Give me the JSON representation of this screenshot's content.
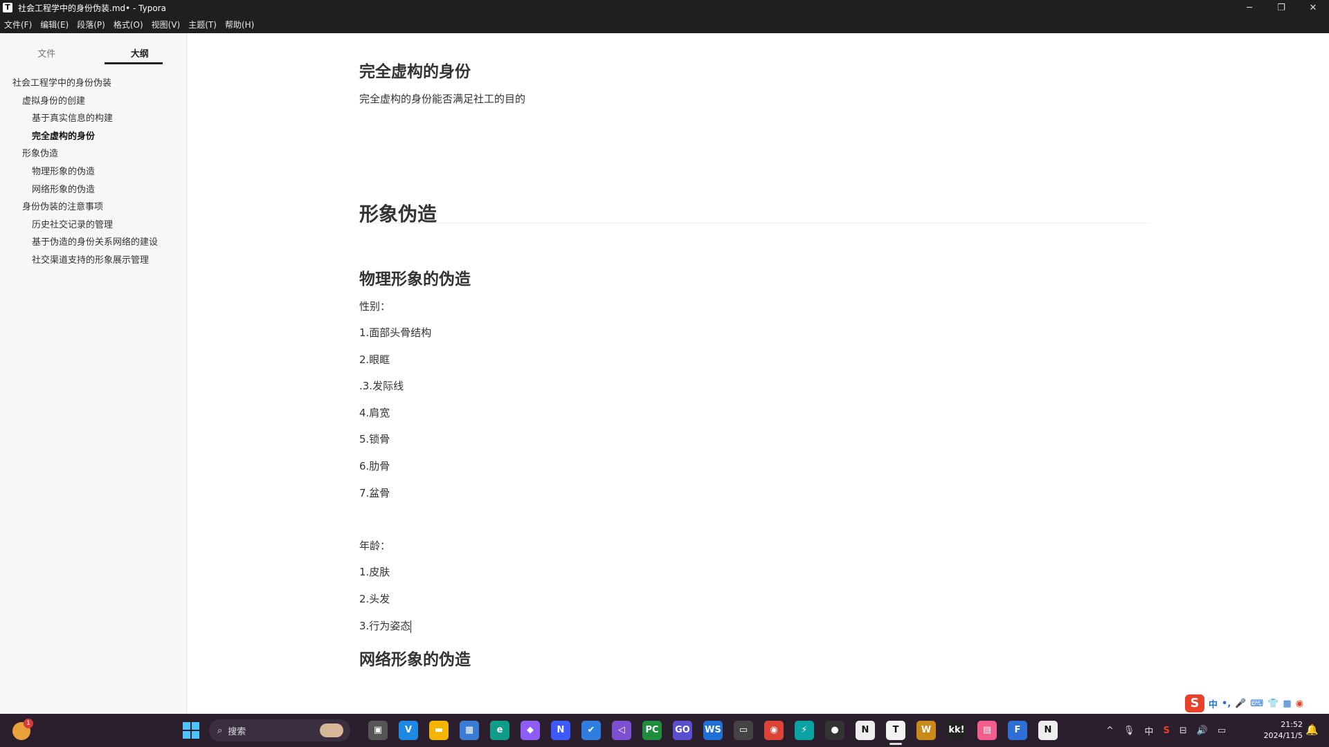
{
  "window": {
    "title": "社会工程学中的身份伪装.md• - Typora",
    "app_icon": "T",
    "controls": {
      "minimize": "─",
      "maximize": "❐",
      "close": "✕"
    }
  },
  "menu": [
    "文件(F)",
    "编辑(E)",
    "段落(P)",
    "格式(O)",
    "视图(V)",
    "主题(T)",
    "帮助(H)"
  ],
  "sidebar": {
    "tabs": [
      "文件",
      "大纲"
    ],
    "active_tab": "大纲",
    "outline": [
      {
        "level": 1,
        "label": "社会工程学中的身份伪装"
      },
      {
        "level": 2,
        "label": "虚拟身份的创建"
      },
      {
        "level": 3,
        "label": "基于真实信息的构建"
      },
      {
        "level": 3,
        "label": "完全虚构的身份",
        "active": true
      },
      {
        "level": 2,
        "label": "形象伪造"
      },
      {
        "level": 3,
        "label": "物理形象的伪造"
      },
      {
        "level": 3,
        "label": "网络形象的伪造"
      },
      {
        "level": 2,
        "label": "身份伪装的注意事项"
      },
      {
        "level": 3,
        "label": "历史社交记录的管理"
      },
      {
        "level": 3,
        "label": "基于伪造的身份关系网络的建设"
      },
      {
        "level": 3,
        "label": "社交渠道支持的形象展示管理"
      }
    ],
    "footer": {
      "back": "‹",
      "source": "</>"
    }
  },
  "document": {
    "h_fictional": "完全虚构的身份",
    "p_fictional": "完全虚构的身份能否满足社工的目的",
    "h_image": "形象伪造",
    "h_physical": "物理形象的伪造",
    "gender_label": "性别：",
    "gender_items": [
      "1.面部头骨结构",
      "2.眼眶",
      ".3.发际线",
      "4.肩宽",
      "5.锁骨",
      "6.肋骨",
      "7.盆骨"
    ],
    "age_label": "年龄：",
    "age_items": [
      "1.皮肤",
      "2.头发",
      "3.行为姿态"
    ],
    "h_online": "网络形象的伪造"
  },
  "ime": {
    "logo": "S",
    "mode": "中",
    "symbols": "•,"
  },
  "taskbar": {
    "search_placeholder": "搜索",
    "weather_badge": "1",
    "apps": [
      {
        "name": "task-view",
        "glyph": "▣",
        "color": "#555"
      },
      {
        "name": "vpn",
        "glyph": "V",
        "color": "#1e88e5"
      },
      {
        "name": "file-explorer",
        "glyph": "▬",
        "color": "#f4b400"
      },
      {
        "name": "ms-store",
        "glyph": "▦",
        "color": "#3a7bd5"
      },
      {
        "name": "edge",
        "glyph": "e",
        "color": "#0f9d8a"
      },
      {
        "name": "copilot",
        "glyph": "◆",
        "color": "#8e5cf7"
      },
      {
        "name": "app-n",
        "glyph": "N",
        "color": "#3d5afe"
      },
      {
        "name": "todo",
        "glyph": "✔",
        "color": "#2f7de1"
      },
      {
        "name": "visual-studio",
        "glyph": "◁",
        "color": "#7b4fcf"
      },
      {
        "name": "pycharm",
        "glyph": "PC",
        "color": "#1d8f3c"
      },
      {
        "name": "goland",
        "glyph": "GO",
        "color": "#5a4fcf"
      },
      {
        "name": "webstorm",
        "glyph": "WS",
        "color": "#1f6fd6"
      },
      {
        "name": "terminal",
        "glyph": "▭",
        "color": "#444"
      },
      {
        "name": "chrome",
        "glyph": "◉",
        "color": "#db4437"
      },
      {
        "name": "bolt-app",
        "glyph": "⚡",
        "color": "#0aa3a3"
      },
      {
        "name": "github",
        "glyph": "●",
        "color": "#333"
      },
      {
        "name": "notion",
        "glyph": "N",
        "color": "#eee"
      },
      {
        "name": "typora",
        "glyph": "T",
        "color": "#f2f2f2"
      },
      {
        "name": "w-app",
        "glyph": "W",
        "color": "#c98a1a"
      },
      {
        "name": "kk-app",
        "glyph": "kk!",
        "color": "#222"
      },
      {
        "name": "bilibili",
        "glyph": "▤",
        "color": "#f25d8e"
      },
      {
        "name": "f-app",
        "glyph": "F",
        "color": "#2e6fd6"
      },
      {
        "name": "notion-2",
        "glyph": "N",
        "color": "#eee"
      }
    ],
    "tray": {
      "chevron": "^",
      "mic": "🎙",
      "ime": "中",
      "sogou": "S",
      "network": "⊟",
      "volume": "🔊",
      "battery": "▭"
    },
    "time": "21:52",
    "date": "2024/11/5",
    "bell": "🔔"
  }
}
